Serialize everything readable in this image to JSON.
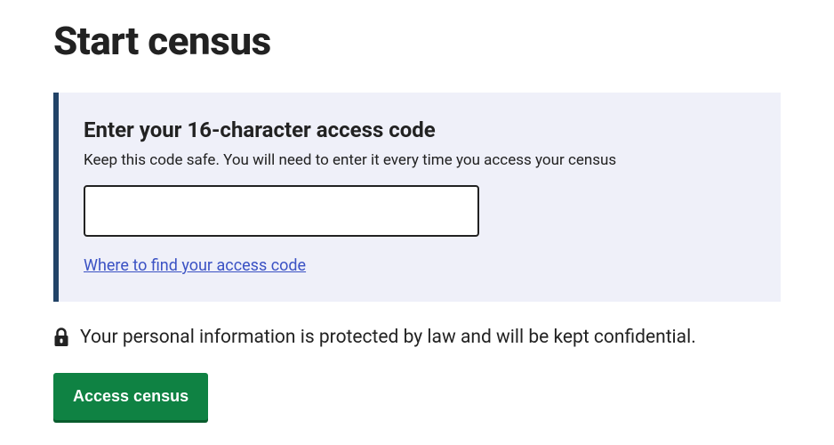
{
  "page": {
    "title": "Start census"
  },
  "panel": {
    "heading": "Enter your 16-character access code",
    "description": "Keep this code safe. You will need to enter it every time you access your census",
    "input_value": "",
    "help_link": "Where to find your access code"
  },
  "security": {
    "notice": "Your personal information is protected by law and will be kept confidential."
  },
  "actions": {
    "submit_label": "Access census"
  }
}
